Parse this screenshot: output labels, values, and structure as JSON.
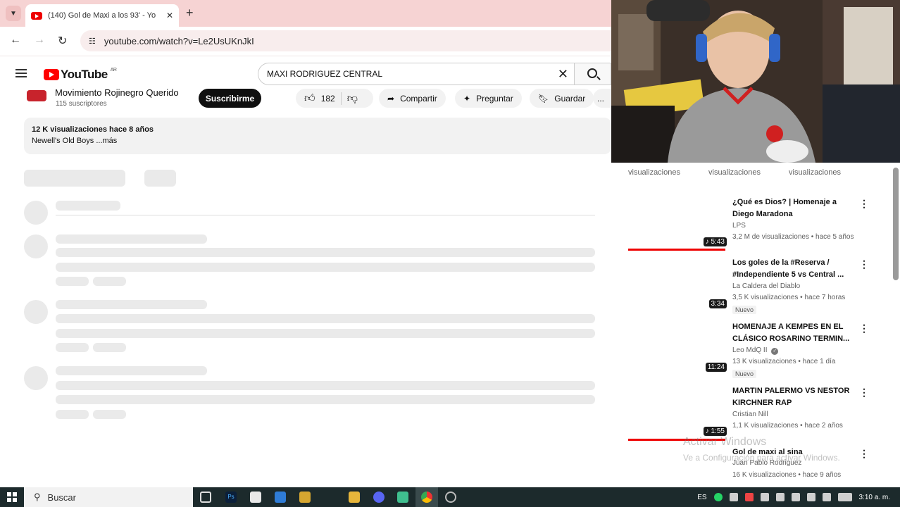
{
  "browser": {
    "tab_title": "(140) Gol de Maxi a los 93' - Yo",
    "url": "youtube.com/watch?v=Le2UsUKnJkI"
  },
  "youtube": {
    "logo_text": "YouTube",
    "logo_region": "AR",
    "search_query": "MAXI RODRIGUEZ CENTRAL"
  },
  "channel": {
    "name": "Movimiento Rojinegro Querido",
    "subscribers": "115 suscriptores",
    "subscribe_label": "Suscribirme"
  },
  "actions": {
    "likes": "182",
    "share": "Compartir",
    "ask": "Preguntar",
    "save": "Guardar",
    "more": "..."
  },
  "description": {
    "stats": "12 K visualizaciones  hace 8 años",
    "text": "Newell's Old Boys ...más"
  },
  "sidebar": {
    "views_labels": [
      "visualizaciones",
      "visualizaciones",
      "visualizaciones"
    ],
    "items": [
      {
        "title": "¿Qué es Dios? | Homenaje a Diego Maradona",
        "channel": "LPS",
        "meta": "3,2 M de visualizaciones • hace 5 años",
        "duration": "♪ 5:43",
        "badge": ""
      },
      {
        "title": "Los goles de la #Reserva / #Independiente 5 vs Central ...",
        "channel": "La Caldera del Diablo",
        "meta": "3,5 K visualizaciones • hace 7 horas",
        "duration": "3:34",
        "badge": "Nuevo"
      },
      {
        "title": "HOMENAJE A KEMPES EN EL CLÁSICO ROSARINO TERMIN...",
        "channel": "Leo MdQ II",
        "meta": "13 K visualizaciones • hace 1 día",
        "duration": "11:24",
        "badge": "Nuevo"
      },
      {
        "title": "MARTIN PALERMO VS NESTOR KIRCHNER RAP",
        "channel": "Cristian Nill",
        "meta": "1,1 K visualizaciones • hace 2 años",
        "duration": "♪ 1:55",
        "badge": ""
      },
      {
        "title": "Gol de maxi al sina",
        "channel": "Juan Pablo Rodriguez",
        "meta": "16 K visualizaciones • hace 9 años",
        "duration": "",
        "badge": ""
      }
    ]
  },
  "watermark": {
    "line1": "Activar Windows",
    "line2": "Ve a Configuración para activar Windows."
  },
  "taskbar": {
    "search_placeholder": "Buscar",
    "language": "ES",
    "time": "3:10 a. m."
  }
}
